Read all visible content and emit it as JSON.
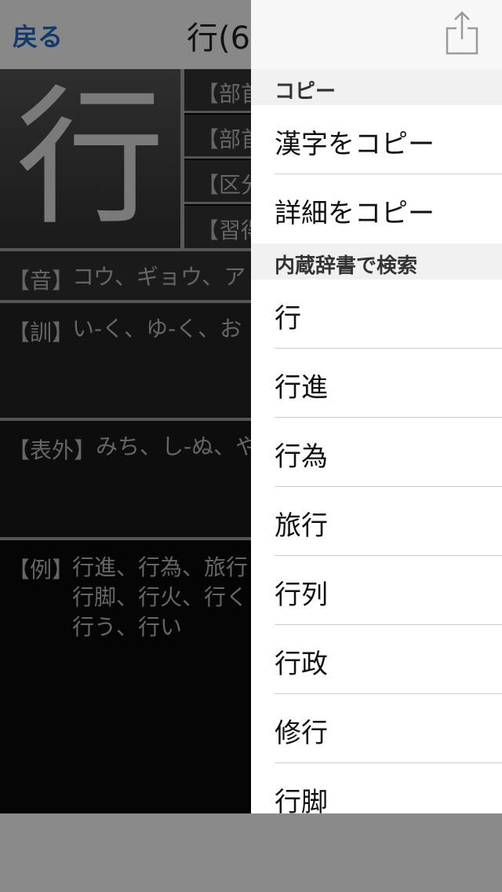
{
  "nav": {
    "back_label": "戻る",
    "title": "行(6"
  },
  "kanji": {
    "char": "行",
    "info_rows": [
      "【部首",
      "【部首",
      "【区分",
      "【習得"
    ]
  },
  "sections": {
    "on": {
      "label": "【音】",
      "text": "コウ、ギョウ、ア"
    },
    "kun": {
      "label": "【訓】",
      "text": "い-く、ゆ-く、お"
    },
    "hyogai": {
      "label": "【表外】",
      "text": "みち、し-ぬ、や"
    },
    "examples": {
      "label": "【例】",
      "text": "行進、行為、旅行\n行脚、行火、行く\n行う、行い"
    }
  },
  "menu": {
    "share_icon": "share-icon",
    "copy_header": "コピー",
    "copy_items": [
      "漢字をコピー",
      "詳細をコピー"
    ],
    "search_header": "内蔵辞書で検索",
    "search_items": [
      "行",
      "行進",
      "行為",
      "旅行",
      "行列",
      "行政",
      "修行",
      "行脚"
    ]
  }
}
